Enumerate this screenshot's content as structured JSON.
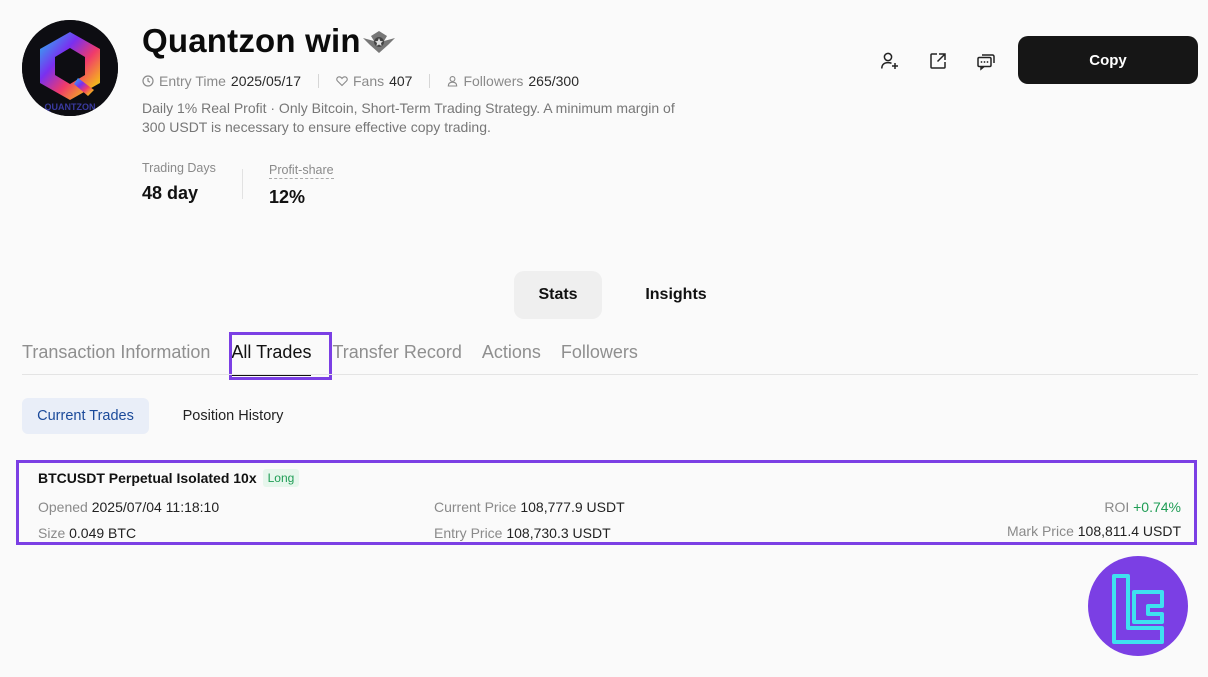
{
  "trader": {
    "name": "Quantzon win",
    "entry_time_label": "Entry Time",
    "entry_time": "2025/05/17",
    "fans_label": "Fans",
    "fans": "407",
    "followers_label": "Followers",
    "followers": "265/300",
    "bio_line1": "Daily 1% Real Profit · Only Bitcoin, Short-Term Trading Strategy. A minimum margin of",
    "bio_line2": "300 USDT is necessary to ensure effective copy trading.",
    "avatar_text": "QUANTZON"
  },
  "stats_summary": {
    "trading_days_label": "Trading Days",
    "trading_days": "48 day",
    "profit_share_label": "Profit-share",
    "profit_share": "12%"
  },
  "actions": {
    "copy_label": "Copy",
    "icons": [
      "add-user-icon",
      "share-icon",
      "message-icon"
    ]
  },
  "view_toggle": {
    "stats_label": "Stats",
    "insights_label": "Insights"
  },
  "tabs": [
    {
      "label": "Transaction Information",
      "active": false
    },
    {
      "label": "All Trades",
      "active": true
    },
    {
      "label": "Transfer Record",
      "active": false
    },
    {
      "label": "Actions",
      "active": false
    },
    {
      "label": "Followers",
      "active": false
    }
  ],
  "subtabs": {
    "current_label": "Current Trades",
    "history_label": "Position History"
  },
  "trade": {
    "title": "BTCUSDT Perpetual Isolated 10x",
    "side": "Long",
    "opened_label": "Opened",
    "opened": "2025/07/04 11:18:10",
    "size_label": "Size",
    "size": "0.049 BTC",
    "current_price_label": "Current Price",
    "current_price": "108,777.9 USDT",
    "entry_price_label": "Entry Price",
    "entry_price": "108,730.3 USDT",
    "roi_label": "ROI",
    "roi": "+0.74%",
    "mark_price_label": "Mark Price",
    "mark_price": "108,811.4 USDT"
  },
  "colors": {
    "highlight": "#7b3fe4",
    "positive": "#1f9d55",
    "copy_button": "#161616"
  }
}
